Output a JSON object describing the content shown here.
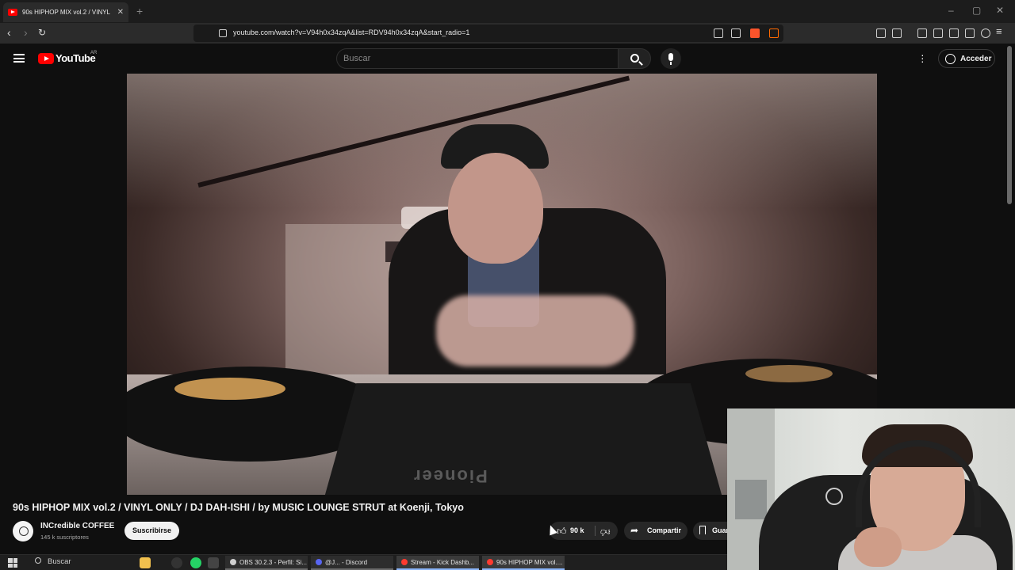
{
  "browser": {
    "tab_title": "90s HIPHOP MIX vol.2 / VINYL",
    "new_tab_glyph": "+",
    "url": "youtube.com/watch?v=V94h0x34zqA&list=RDV94h0x34zqA&start_radio=1",
    "window_controls": [
      "–",
      "▢",
      "✕"
    ]
  },
  "youtube": {
    "logo_text": "YouTube",
    "country": "AR",
    "search_placeholder": "Buscar",
    "signin_label": "Acceder"
  },
  "video": {
    "title": "90s HIPHOP MIX vol.2 / VINYL ONLY / DJ DAH-ISHI / by MUSIC LOUNGE STRUT at Koenji, Tokyo",
    "mixer_brand": "Pioneer",
    "channel_name": "INCredible COFFEE",
    "channel_subs": "145 k suscriptores",
    "subscribe_label": "Suscribirse",
    "likes": "90 k",
    "share_label": "Compartir",
    "save_label": "Guardar"
  },
  "taskbar": {
    "search_label": "Buscar",
    "tasks": [
      {
        "label": "OBS 30.2.3 - Perfil: Si...",
        "color": "#d0d0d0"
      },
      {
        "label": "@J... - Discord",
        "color": "#5865f2"
      },
      {
        "label": "Stream - Kick Dashb...",
        "color": "#ff3b30"
      },
      {
        "label": "90s HIPHOP MIX vol....",
        "color": "#ff3b30"
      }
    ]
  },
  "colors": {
    "youtube_red": "#ff0000",
    "background": "#0f0f0f",
    "chip": "#272727"
  }
}
